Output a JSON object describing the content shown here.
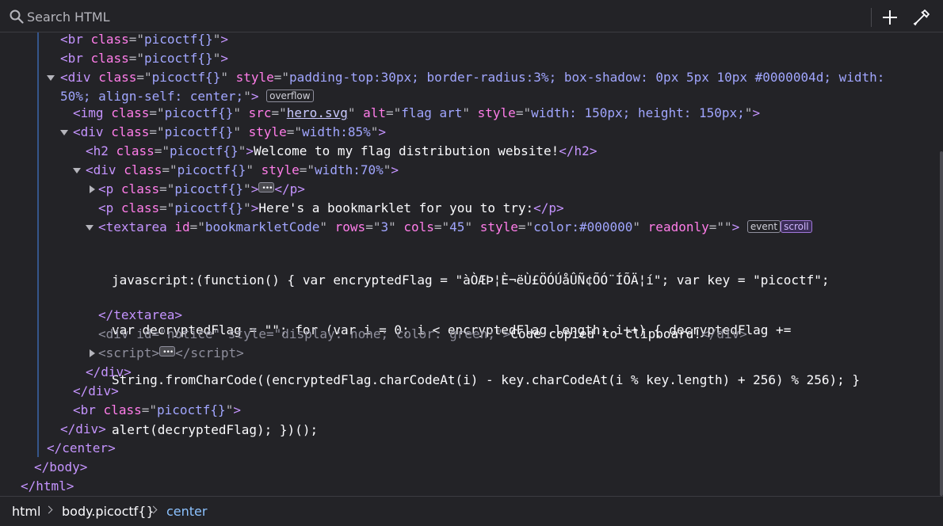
{
  "search": {
    "placeholder": "Search HTML"
  },
  "toolbar": {
    "add_icon": "plus-icon",
    "picker_icon": "eyedropper-icon"
  },
  "tree": {
    "br1": {
      "tag": "br",
      "class": "picoctf{}"
    },
    "br2": {
      "tag": "br",
      "class": "picoctf{}"
    },
    "div_container": {
      "tag": "div",
      "class": "picoctf{}",
      "style_line1": "padding-top:30px; border-radius:3%; box-shadow: 0px 5px 10px #0000004d; width:",
      "style_line2": "50%; align-self: center;",
      "badge": "overflow"
    },
    "img": {
      "tag": "img",
      "class": "picoctf{}",
      "src": "hero.svg",
      "alt": "flag art",
      "style": "width: 150px; height: 150px;"
    },
    "div85": {
      "tag": "div",
      "class": "picoctf{}",
      "style": "width:85%"
    },
    "h2": {
      "tag": "h2",
      "class": "picoctf{}",
      "text": "Welcome to my flag distribution website!"
    },
    "div70": {
      "tag": "div",
      "class": "picoctf{}",
      "style": "width:70%"
    },
    "p1": {
      "tag": "p",
      "class": "picoctf{}"
    },
    "p2": {
      "tag": "p",
      "class": "picoctf{}",
      "text": "Here's a bookmarklet for you to try:"
    },
    "textarea": {
      "tag": "textarea",
      "id": "bookmarkletCode",
      "rows": "3",
      "cols": "45",
      "style": "color:#000000",
      "readonly": "",
      "badge_event": "event",
      "badge_scroll": "scroll",
      "code_line1": "javascript:(function() { var encryptedFlag = \"àÒÆÞ¦È¬ëÙ£ÖÓÚåÛÑ¢ÕÓ¨ÍÕÄ¦í\"; var key = \"picoctf\";",
      "code_line2": "var decryptedFlag = \"\"; for (var i = 0; i < encryptedFlag.length; i++) { decryptedFlag +=",
      "code_line3": "String.fromCharCode((encryptedFlag.charCodeAt(i) - key.charCodeAt(i % key.length) + 256) % 256); }",
      "code_line4": "alert(decryptedFlag); })();"
    },
    "notice": {
      "tag": "div",
      "id": "notice",
      "style": "display: none; color: green;",
      "text": "Code copied to clipboard!"
    },
    "script": {
      "tag": "script"
    },
    "br3": {
      "tag": "br",
      "class": "picoctf{}"
    },
    "center": {
      "tag": "center"
    },
    "body": {
      "tag": "body"
    },
    "html": {
      "tag": "html"
    }
  },
  "breadcrumbs": [
    {
      "label": "html"
    },
    {
      "label": "body.picoctf{}"
    },
    {
      "label": "center"
    }
  ]
}
